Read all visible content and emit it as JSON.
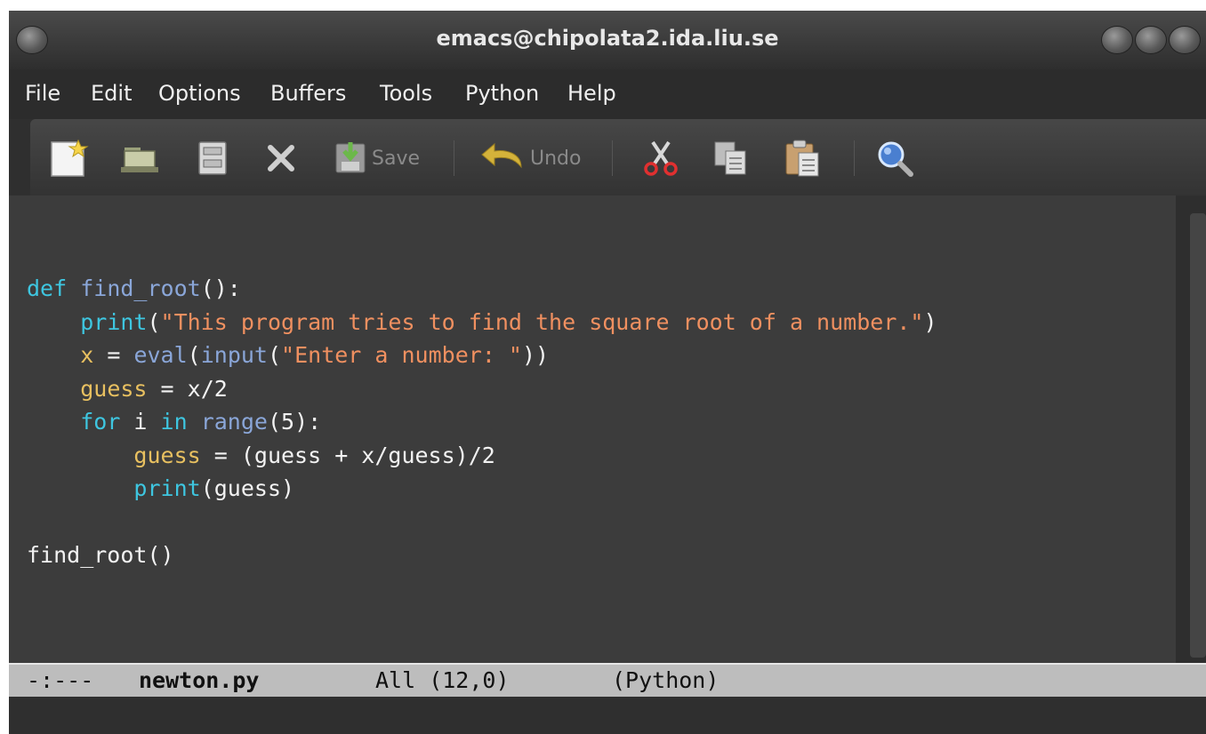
{
  "window": {
    "title": "emacs@chipolata2.ida.liu.se"
  },
  "menu": [
    "File",
    "Edit",
    "Options",
    "Buffers",
    "Tools",
    "Python",
    "Help"
  ],
  "toolbar": {
    "save_label": "Save",
    "undo_label": "Undo",
    "icons": [
      "new-file-icon",
      "open-folder-icon",
      "open-directory-icon",
      "close-icon",
      "save-icon",
      "undo-icon",
      "cut-icon",
      "copy-icon",
      "paste-icon",
      "search-icon"
    ]
  },
  "editor": {
    "lines": [
      "",
      "def find_root():",
      "    print(\"This program tries to find the square root of a number.\")",
      "    x = eval(input(\"Enter a number: \"))",
      "    guess = x/2",
      "    for i in range(5):",
      "        guess = (guess + x/guess)/2",
      "        print(guess)",
      "",
      "find_root()"
    ]
  },
  "modeline": {
    "status": "-:---",
    "buffer": "newton.py",
    "position": "All (12,0)",
    "mode": "(Python)"
  },
  "colors": {
    "keyword": "#3ec6e0",
    "function_name": "#8aa6d8",
    "string": "#f09060",
    "variable": "#e8c060",
    "editor_bg": "#3c3c3c",
    "modeline_bg": "#bdbdbd"
  }
}
